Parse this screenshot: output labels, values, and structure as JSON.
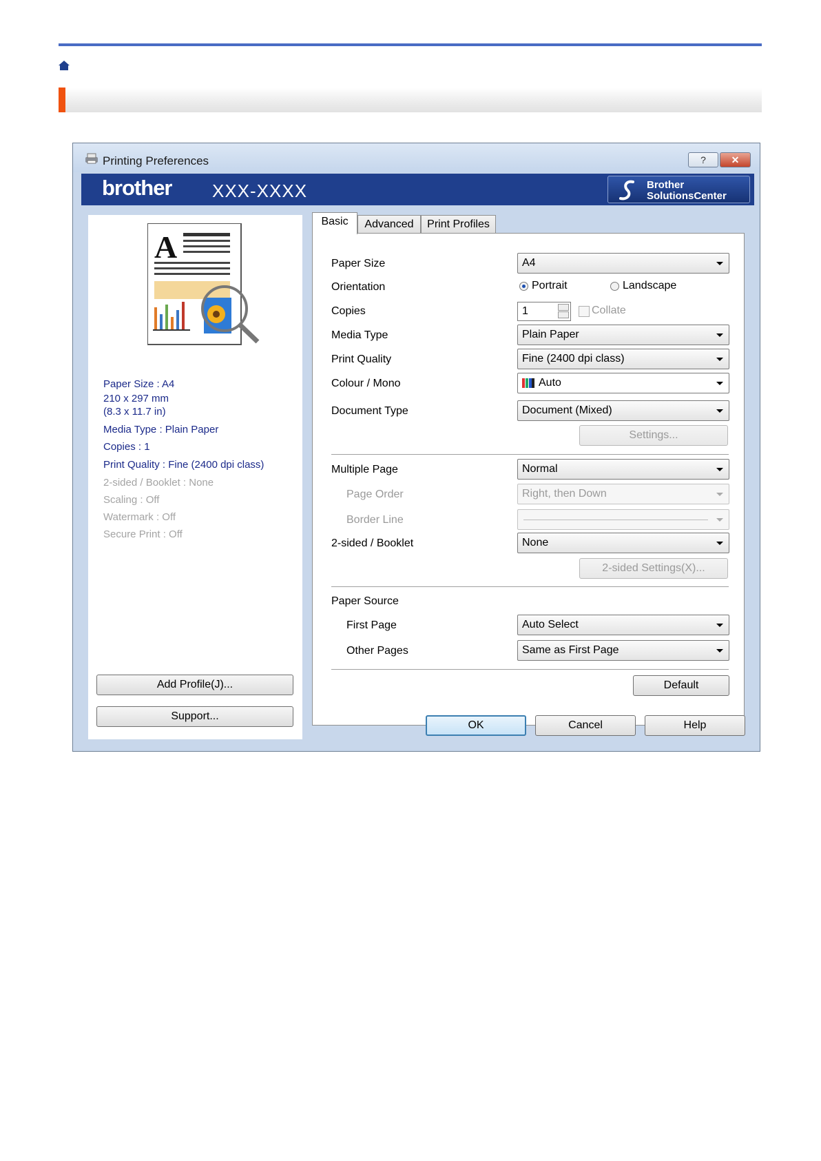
{
  "dialog": {
    "title": "Printing Preferences",
    "help_button": "?",
    "close_button": "✕",
    "brand": "brother",
    "model": "XXX-XXXX",
    "solutions_center": {
      "line1": "Brother",
      "line2": "SolutionsCenter"
    }
  },
  "summary": {
    "paper_size": "Paper Size : A4",
    "dims_mm": "210 x 297 mm",
    "dims_in": "(8.3 x 11.7 in)",
    "media_type": "Media Type : Plain Paper",
    "copies": "Copies : 1",
    "print_quality": "Print Quality : Fine (2400 dpi class)",
    "two_sided": "2-sided / Booklet : None",
    "scaling": "Scaling : Off",
    "watermark": "Watermark : Off",
    "secure_print": "Secure Print : Off"
  },
  "left_buttons": {
    "add_profile": "Add Profile(J)...",
    "support": "Support..."
  },
  "tabs": [
    "Basic",
    "Advanced",
    "Print Profiles"
  ],
  "basic": {
    "paper_size": {
      "label": "Paper Size",
      "value": "A4"
    },
    "orientation": {
      "label": "Orientation",
      "portrait": "Portrait",
      "landscape": "Landscape",
      "selected": "Portrait"
    },
    "copies": {
      "label": "Copies",
      "value": "1",
      "collate": "Collate"
    },
    "media_type": {
      "label": "Media Type",
      "value": "Plain Paper"
    },
    "print_quality": {
      "label": "Print Quality",
      "value": "Fine (2400 dpi class)"
    },
    "colour_mono": {
      "label": "Colour / Mono",
      "value": "Auto"
    },
    "document_type": {
      "label": "Document Type",
      "value": "Document (Mixed)"
    },
    "settings_button": "Settings...",
    "multiple_page": {
      "label": "Multiple Page",
      "value": "Normal"
    },
    "page_order": {
      "label": "Page Order",
      "value": "Right, then Down"
    },
    "border_line": {
      "label": "Border Line",
      "value": ""
    },
    "two_sided": {
      "label": "2-sided / Booklet",
      "value": "None"
    },
    "two_sided_settings": "2-sided Settings(X)...",
    "paper_source": {
      "label": "Paper Source"
    },
    "first_page": {
      "label": "First Page",
      "value": "Auto Select"
    },
    "other_pages": {
      "label": "Other Pages",
      "value": "Same as First Page"
    },
    "default_button": "Default"
  },
  "footer_buttons": {
    "ok": "OK",
    "cancel": "Cancel",
    "help": "Help"
  }
}
